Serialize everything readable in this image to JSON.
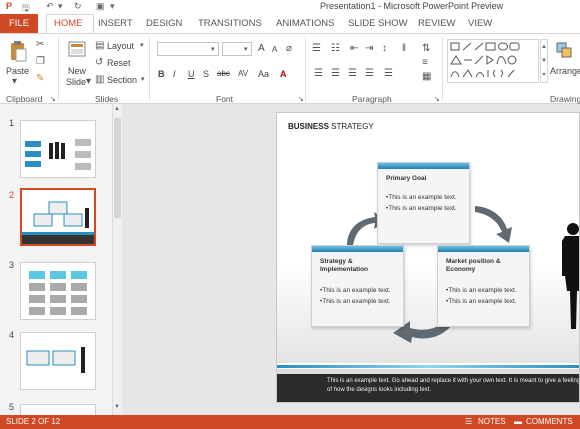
{
  "window": {
    "title": "Presentation1 - Microsoft PowerPoint Preview"
  },
  "tabs": {
    "file": "FILE",
    "items": [
      "HOME",
      "INSERT",
      "DESIGN",
      "TRANSITIONS",
      "ANIMATIONS",
      "SLIDE SHOW",
      "REVIEW",
      "VIEW"
    ]
  },
  "ribbon": {
    "clipboard": {
      "paste": "Paste",
      "label": "Clipboard"
    },
    "slides": {
      "new_slide_1": "New",
      "new_slide_2": "Slide",
      "layout": "Layout",
      "reset": "Reset",
      "section": "Section",
      "label": "Slides"
    },
    "font": {
      "label": "Font",
      "bold": "B",
      "italic": "I",
      "underline": "U",
      "shadow": "S",
      "strike": "abc",
      "spacing": "AV",
      "case": "Aa",
      "grow": "A",
      "shrink": "A"
    },
    "paragraph": {
      "label": "Paragraph"
    },
    "drawing": {
      "arrange_1": "Arrange",
      "label": "Drawing"
    }
  },
  "thumbnails": [
    {
      "number": "1",
      "selected": false
    },
    {
      "number": "2",
      "selected": true
    },
    {
      "number": "3",
      "selected": false
    },
    {
      "number": "4",
      "selected": false
    },
    {
      "number": "5",
      "selected": false
    }
  ],
  "slide": {
    "title_bold": "BUSINESS",
    "title_rest": " STRATEGY",
    "boxes": {
      "primary": {
        "heading": "Primary Goal",
        "line1": "•This is an example text.",
        "line2": "•This is an example text."
      },
      "left": {
        "heading": "Strategy & Implementation",
        "line1": "•This is an example text.",
        "line2": "•This is an example text."
      },
      "right": {
        "heading": "Market position & Economy",
        "line1": "•This is an example text.",
        "line2": "•This is an example text."
      }
    },
    "footer": "This is an example text. Go ahead and replace it with your own text. It is meant to give a feeling of how the designs looks including text."
  },
  "status": {
    "slide": "SLIDE 2 OF 12",
    "notes": "NOTES",
    "comments": "COMMENTS"
  },
  "colors": {
    "accent": "#d04925",
    "box_header": "#1d7fb4"
  }
}
